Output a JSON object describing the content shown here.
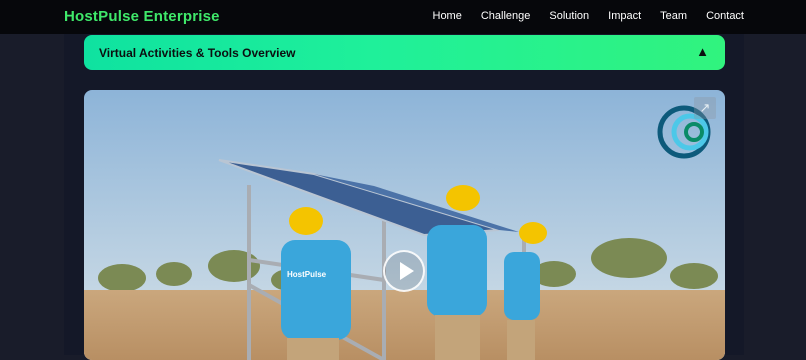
{
  "navbar": {
    "brand": "HostPulse Enterprise",
    "links": [
      "Home",
      "Challenge",
      "Solution",
      "Impact",
      "Team",
      "Contact"
    ]
  },
  "accordion": {
    "title": "Virtual Activities & Tools Overview",
    "toggle_icon": "▲"
  },
  "video": {
    "shirt_logo": "HostPulse",
    "play_icon": "play-icon",
    "external_icon": "↗"
  },
  "colors": {
    "accent": "#3fe86a",
    "banner_start": "#0fe2a0",
    "banner_end": "#31f37e"
  }
}
